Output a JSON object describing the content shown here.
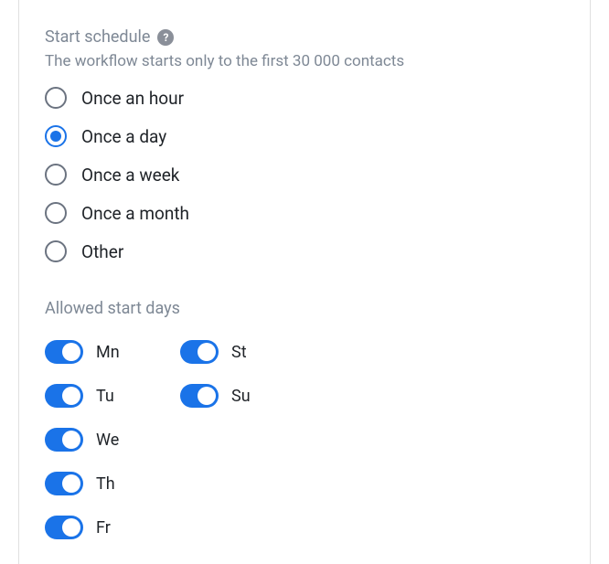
{
  "schedule": {
    "title": "Start schedule",
    "help_tooltip": "?",
    "subtitle": "The workflow starts only to the first 30 000 contacts",
    "options": [
      {
        "label": "Once an hour",
        "selected": false
      },
      {
        "label": "Once a day",
        "selected": true
      },
      {
        "label": "Once a week",
        "selected": false
      },
      {
        "label": "Once a month",
        "selected": false
      },
      {
        "label": "Other",
        "selected": false
      }
    ]
  },
  "allowed_days": {
    "title": "Allowed start days",
    "days": [
      {
        "code": "Mn",
        "enabled": true
      },
      {
        "code": "Tu",
        "enabled": true
      },
      {
        "code": "We",
        "enabled": true
      },
      {
        "code": "Th",
        "enabled": true
      },
      {
        "code": "Fr",
        "enabled": true
      },
      {
        "code": "St",
        "enabled": true
      },
      {
        "code": "Su",
        "enabled": true
      }
    ]
  }
}
